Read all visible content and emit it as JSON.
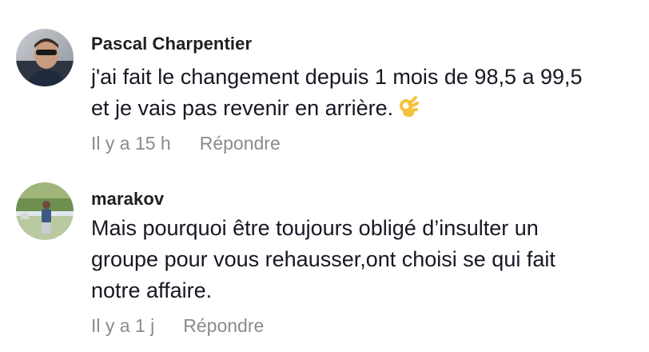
{
  "comments": [
    {
      "author": "Pascal Charpentier",
      "text_line1": "j'ai fait le changement depuis 1 mois de 98,5 a 99,5",
      "text_line2": "et je vais pas revenir en arrière.",
      "emoji": "ok-hand-icon",
      "time": "Il y a 15 h",
      "reply_label": "Répondre"
    },
    {
      "author": "marakov",
      "text_line1": "Mais pourquoi être toujours obligé d’insulter un",
      "text_line2": "groupe pour vous rehausser,ont choisi se qui fait",
      "text_line3": "notre affaire.",
      "time": "Il y a 1 j",
      "reply_label": "Répondre"
    }
  ],
  "colors": {
    "author": "#1f1f1f",
    "text": "#161823",
    "meta": "#8a8b91",
    "emoji": "#f5c33b"
  }
}
